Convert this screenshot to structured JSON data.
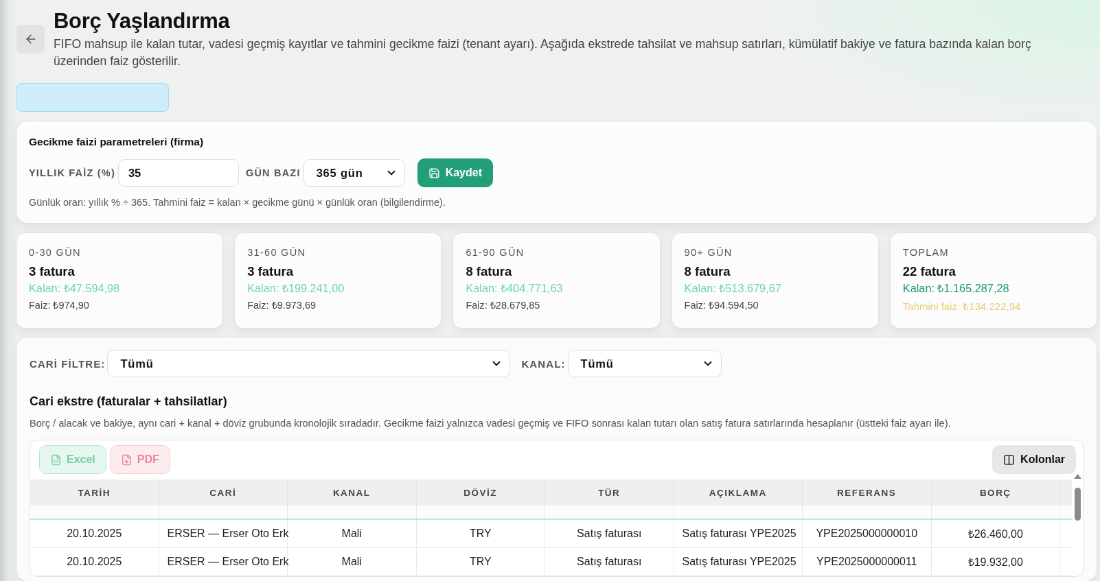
{
  "header": {
    "title": "Borç Yaşlandırma",
    "description": "FIFO mahsup ile kalan tutar, vadesi geçmiş kayıtlar ve tahmini gecikme faizi (tenant ayarı). Aşağıda ekstrede tahsilat ve mahsup satırları, kümülatif bakiye ve fatura bazında kalan borç üzerinden faiz gösterilir."
  },
  "top_button": {
    "disabled": true
  },
  "interest_settings": {
    "title": "Gecikme faizi parametreleri (firma)",
    "annual_rate": {
      "label": "YILLIK FAİZ (%)",
      "value": "35"
    },
    "day_basis": {
      "label": "GÜN BAZI",
      "value": "365 gün"
    },
    "save_button": "Kaydet",
    "note": "Günlük oran: yıllık % ÷ 365. Tahmini faiz = kalan × gecikme günü × günlük oran (bilgilendirme)."
  },
  "aging_cards": [
    {
      "kind": "bucket",
      "label": "0-30 GÜN",
      "count": "3 fatura",
      "remaining": "Kalan: ₺47.594,98",
      "interest": "Faiz: ₺974,90"
    },
    {
      "kind": "bucket",
      "label": "31-60 GÜN",
      "count": "3 fatura",
      "remaining": "Kalan: ₺199.241,00",
      "interest": "Faiz: ₺9.973,69"
    },
    {
      "kind": "bucket",
      "label": "61-90 GÜN",
      "count": "8 fatura",
      "remaining": "Kalan: ₺404.771,63",
      "interest": "Faiz: ₺28.679,85"
    },
    {
      "kind": "bucket",
      "label": "90+ GÜN",
      "count": "8 fatura",
      "remaining": "Kalan: ₺513.679,67",
      "interest": "Faiz: ₺94.594,50"
    },
    {
      "kind": "total",
      "label": "TOPLAM",
      "count": "22 fatura",
      "remaining": "Kalan: ₺1.165.287,28",
      "interest": "Tahmini faiz: ₺134.222,94"
    }
  ],
  "filters": [
    {
      "label": "CARİ FİLTRE:",
      "value": "Tümü"
    },
    {
      "label": "KANAL:",
      "value": "Tümü"
    }
  ],
  "statement": {
    "title": "Cari ekstre (faturalar + tahsilatlar)",
    "description": "Borç / alacak ve bakiye, aynı cari + kanal + döviz grubunda kronolojik sıradadır. Gecikme faizi yalnızca vadesi geçmiş ve FIFO sonrası kalan tutarı olan satış fatura satırlarında hesaplanır (üstteki faiz ayarı ile).",
    "export_buttons": [
      {
        "kind": "excel",
        "label": "Excel",
        "disabled": true
      },
      {
        "kind": "pdf",
        "label": "PDF",
        "disabled": true
      }
    ],
    "columns_button": "Kolonlar",
    "table": {
      "columns": [
        "TARİH",
        "CARİ",
        "KANAL",
        "DÖVİZ",
        "TÜR",
        "AÇIKLAMA",
        "REFERANS",
        "BORÇ"
      ],
      "rows": [
        {
          "cells": [
            "20.10.2025",
            "ERSER — Erser Oto Erk",
            "Mali",
            "TRY",
            "Satış faturası",
            "Satış faturası YPE2025",
            "YPE2025000000010",
            "₺26.460,00"
          ]
        },
        {
          "cells": [
            "20.10.2025",
            "ERSER — Erser Oto Erk",
            "Mali",
            "TRY",
            "Satış faturası",
            "Satış faturası YPE2025",
            "YPE2025000000011",
            "₺19.932,00"
          ]
        }
      ]
    }
  }
}
